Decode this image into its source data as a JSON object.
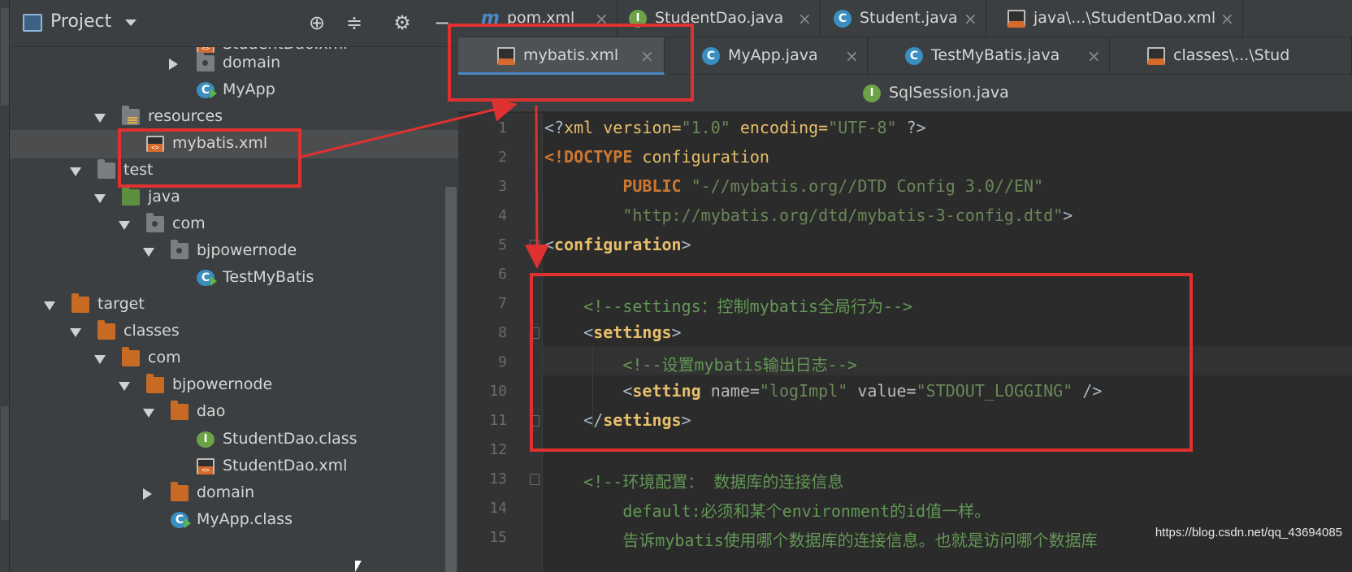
{
  "project_panel": {
    "title": "Project",
    "tree": [
      {
        "label": "StudentDao.xml",
        "icon": "xml-file-icon",
        "arrow": "none"
      },
      {
        "label": "domain",
        "icon": "package-folder-icon",
        "arrow": "right"
      },
      {
        "label": "MyApp",
        "icon": "java-class-icon",
        "arrow": "none"
      },
      {
        "label": "resources",
        "icon": "resources-folder-icon",
        "arrow": "down"
      },
      {
        "label": "mybatis.xml",
        "icon": "xml-file-icon",
        "arrow": "none",
        "selected": true
      },
      {
        "label": "test",
        "icon": "folder-icon",
        "arrow": "down"
      },
      {
        "label": "java",
        "icon": "source-folder-icon",
        "arrow": "down"
      },
      {
        "label": "com",
        "icon": "package-folder-icon",
        "arrow": "down"
      },
      {
        "label": "bjpowernode",
        "icon": "package-folder-icon",
        "arrow": "down"
      },
      {
        "label": "TestMyBatis",
        "icon": "java-class-icon",
        "arrow": "none"
      },
      {
        "label": "target",
        "icon": "output-folder-icon",
        "arrow": "down"
      },
      {
        "label": "classes",
        "icon": "output-folder-icon",
        "arrow": "down"
      },
      {
        "label": "com",
        "icon": "output-folder-icon",
        "arrow": "down"
      },
      {
        "label": "bjpowernode",
        "icon": "output-folder-icon",
        "arrow": "down"
      },
      {
        "label": "dao",
        "icon": "output-folder-icon",
        "arrow": "down"
      },
      {
        "label": "StudentDao.class",
        "icon": "interface-class-icon",
        "arrow": "none"
      },
      {
        "label": "StudentDao.xml",
        "icon": "xml-file-icon",
        "arrow": "none"
      },
      {
        "label": "domain",
        "icon": "output-folder-icon",
        "arrow": "right"
      },
      {
        "label": "MyApp.class",
        "icon": "java-class-icon",
        "arrow": "none"
      }
    ]
  },
  "tabs_row1": [
    {
      "label": "pom.xml",
      "icon": "maven-icon"
    },
    {
      "label": "StudentDao.java",
      "icon": "interface-icon"
    },
    {
      "label": "Student.java",
      "icon": "class-icon"
    },
    {
      "label": "java\\...\\StudentDao.xml",
      "icon": "xml-file-icon"
    }
  ],
  "tabs_row2": [
    {
      "label": "mybatis.xml",
      "icon": "xml-file-icon",
      "active": true
    },
    {
      "label": "MyApp.java",
      "icon": "class-icon"
    },
    {
      "label": "TestMyBatis.java",
      "icon": "class-icon"
    },
    {
      "label": "classes\\...\\Stud",
      "icon": "xml-file-icon"
    }
  ],
  "tabs_row3": [
    {
      "label": "SqlSession.java",
      "icon": "interface-lock-icon"
    }
  ],
  "editor": {
    "line_numbers": [
      "1",
      "2",
      "3",
      "4",
      "5",
      "6",
      "7",
      "8",
      "9",
      "10",
      "11",
      "12",
      "13",
      "14",
      "15"
    ],
    "lines": [
      [
        {
          "t": "<?",
          "c": "t-plain"
        },
        {
          "t": "xml version=",
          "c": "t-pi"
        },
        {
          "t": "\"1.0\"",
          "c": "t-xmlstr"
        },
        {
          "t": " encoding=",
          "c": "t-pi"
        },
        {
          "t": "\"UTF-8\"",
          "c": "t-xmlstr"
        },
        {
          "t": " ?>",
          "c": "t-plain"
        }
      ],
      [
        {
          "t": "<!DOCTYPE ",
          "c": "t-doc"
        },
        {
          "t": "configuration",
          "c": "t-pi"
        }
      ],
      [
        {
          "t": "        PUBLIC ",
          "c": "t-doc"
        },
        {
          "t": "\"-//mybatis.org//DTD Config 3.0//EN\"",
          "c": "t-xmlstr"
        }
      ],
      [
        {
          "t": "        \"http://mybatis.org/dtd/mybatis-3-config.dtd\"",
          "c": "t-xmlstr"
        },
        {
          "t": ">",
          "c": "t-plain"
        }
      ],
      [
        {
          "t": "<",
          "c": "t-plain"
        },
        {
          "t": "configuration",
          "c": "t-tag"
        },
        {
          "t": ">",
          "c": "t-plain"
        }
      ],
      [
        {
          "t": "",
          "c": "t-plain"
        }
      ],
      [
        {
          "t": "    <!--settings：控制mybatis全局行为-->",
          "c": "t-cmt"
        }
      ],
      [
        {
          "t": "    <",
          "c": "t-plain"
        },
        {
          "t": "settings",
          "c": "t-tag"
        },
        {
          "t": ">",
          "c": "t-plain"
        }
      ],
      [
        {
          "t": "        <!--设置mybatis输出日志-->",
          "c": "t-cmt"
        }
      ],
      [
        {
          "t": "        <",
          "c": "t-plain"
        },
        {
          "t": "setting ",
          "c": "t-tag"
        },
        {
          "t": "name=",
          "c": "t-attr"
        },
        {
          "t": "\"logImpl\"",
          "c": "t-xmlstr"
        },
        {
          "t": " value=",
          "c": "t-attr"
        },
        {
          "t": "\"STDOUT_LOGGING\"",
          "c": "t-xmlstr"
        },
        {
          "t": " />",
          "c": "t-plain"
        }
      ],
      [
        {
          "t": "    </",
          "c": "t-plain"
        },
        {
          "t": "settings",
          "c": "t-tag"
        },
        {
          "t": ">",
          "c": "t-plain"
        }
      ],
      [
        {
          "t": "",
          "c": "t-plain"
        }
      ],
      [
        {
          "t": "    <!--环境配置： 数据库的连接信息",
          "c": "t-cmt"
        }
      ],
      [
        {
          "t": "        default:必须和某个environment的id值一样。",
          "c": "t-cmt"
        }
      ],
      [
        {
          "t": "        告诉mybatis使用哪个数据库的连接信息。也就是访问哪个数据库",
          "c": "t-cmt"
        }
      ]
    ]
  },
  "watermark": "https://blog.csdn.net/qq_43694085"
}
